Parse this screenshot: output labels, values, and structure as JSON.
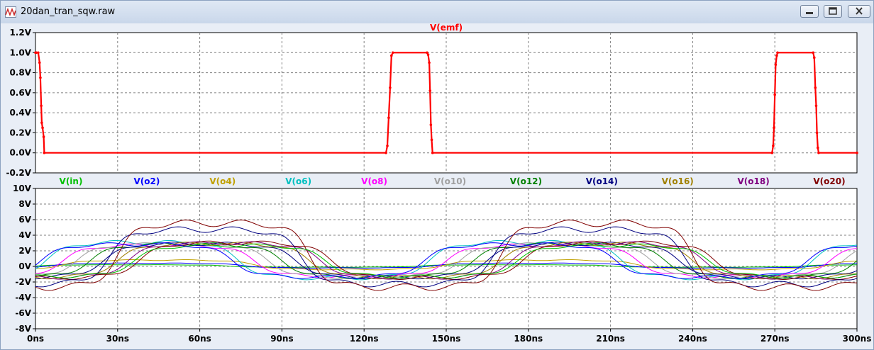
{
  "window": {
    "title": "20dan_tran_sqw.raw",
    "app_icon": "waveform-icon",
    "buttons": [
      "minimize-icon",
      "maximize-icon",
      "close-icon"
    ]
  },
  "chart_data": [
    {
      "type": "line",
      "title": "V(emf)",
      "xlabel": "",
      "ylabel": "",
      "xlim": [
        0,
        300
      ],
      "ylim": [
        -0.2,
        1.2
      ],
      "grid": true,
      "x_ticks": [
        "0ns",
        "30ns",
        "60ns",
        "90ns",
        "120ns",
        "150ns",
        "180ns",
        "210ns",
        "240ns",
        "270ns",
        "300ns"
      ],
      "y_ticks": [
        "1.2V",
        "1.0V",
        "0.8V",
        "0.6V",
        "0.4V",
        "0.2V",
        "0.0V",
        "-0.2V"
      ],
      "series": [
        {
          "name": "V(emf)",
          "color": "#ff0000",
          "markers": true,
          "x": [
            0,
            0.3,
            1.0,
            1.5,
            1.8,
            2.1,
            2.3,
            2.6,
            3.0,
            3.2,
            128.0,
            128.5,
            129.0,
            129.5,
            130.0,
            130.5,
            143.0,
            143.4,
            143.8,
            144.1,
            144.4,
            144.7,
            145.0,
            269.0,
            269.4,
            269.7,
            270.0,
            270.3,
            270.7,
            271.0,
            284.0,
            284.4,
            284.8,
            285.1,
            285.4,
            285.7,
            286.0,
            300.0
          ],
          "y": [
            1.0,
            1.0,
            1.0,
            0.9,
            0.75,
            0.47,
            0.3,
            0.25,
            0.16,
            0.0,
            0.0,
            0.07,
            0.35,
            0.65,
            0.97,
            1.0,
            1.0,
            0.98,
            0.9,
            0.62,
            0.28,
            0.13,
            0.0,
            0.0,
            0.07,
            0.25,
            0.58,
            0.88,
            0.97,
            1.0,
            1.0,
            0.95,
            0.65,
            0.47,
            0.2,
            0.05,
            0.0,
            0.0
          ]
        }
      ]
    },
    {
      "type": "line",
      "title": "",
      "xlabel": "",
      "ylabel": "",
      "xlim": [
        0,
        300
      ],
      "ylim": [
        -8,
        10
      ],
      "grid": true,
      "period": 140,
      "x_ticks": [
        "0ns",
        "30ns",
        "60ns",
        "90ns",
        "120ns",
        "150ns",
        "180ns",
        "210ns",
        "240ns",
        "270ns",
        "300ns"
      ],
      "y_ticks": [
        "10V",
        "8V",
        "6V",
        "4V",
        "2V",
        "0V",
        "-2V",
        "-4V",
        "-6V",
        "-8V"
      ],
      "legend": "top",
      "series": [
        {
          "name": "V(in)",
          "color": "#00c000",
          "amp": 0.3,
          "delay": 0,
          "width": 8
        },
        {
          "name": "V(o2)",
          "color": "#0000ff",
          "amp": 0.6,
          "delay": 6,
          "width": 8
        },
        {
          "name": "V(o4)",
          "color": "#c0a000",
          "amp": 1.2,
          "delay": 10,
          "width": 8
        },
        {
          "name": "V(o6)",
          "color": "#00c0c0",
          "amp": 4.6,
          "delay": 4,
          "width": 8
        },
        {
          "name": "V(o8)",
          "color": "#ff00ff",
          "amp": 4.0,
          "delay": 10,
          "width": 8
        },
        {
          "name": "V(o10)",
          "color": "#a0a0a0",
          "amp": 4.2,
          "delay": 15,
          "width": 8
        },
        {
          "name": "V(o12)",
          "color": "#008000",
          "amp": 4.2,
          "delay": 20,
          "width": 8
        },
        {
          "name": "V(o14)",
          "color": "#000080",
          "amp": 4.3,
          "delay": 25,
          "width": 8
        },
        {
          "name": "V(o16)",
          "color": "#a08000",
          "amp": 4.3,
          "delay": 30,
          "width": 8
        },
        {
          "name": "V(o18)",
          "color": "#800080",
          "amp": 4.4,
          "delay": 34,
          "width": 8
        },
        {
          "name": "V(o20)",
          "color": "#800000",
          "amp": 4.5,
          "delay": 38,
          "width": 8
        }
      ],
      "extra_traces": [
        {
          "color": "#000080",
          "amp": 7.0,
          "delay": 27,
          "width": 5
        },
        {
          "color": "#800000",
          "amp": 8.2,
          "delay": 30,
          "width": 4
        },
        {
          "color": "#00c000",
          "amp": 4.0,
          "delay": 36,
          "width": 8
        },
        {
          "color": "#0000ff",
          "amp": 4.2,
          "delay": 2,
          "width": 8
        }
      ]
    }
  ]
}
